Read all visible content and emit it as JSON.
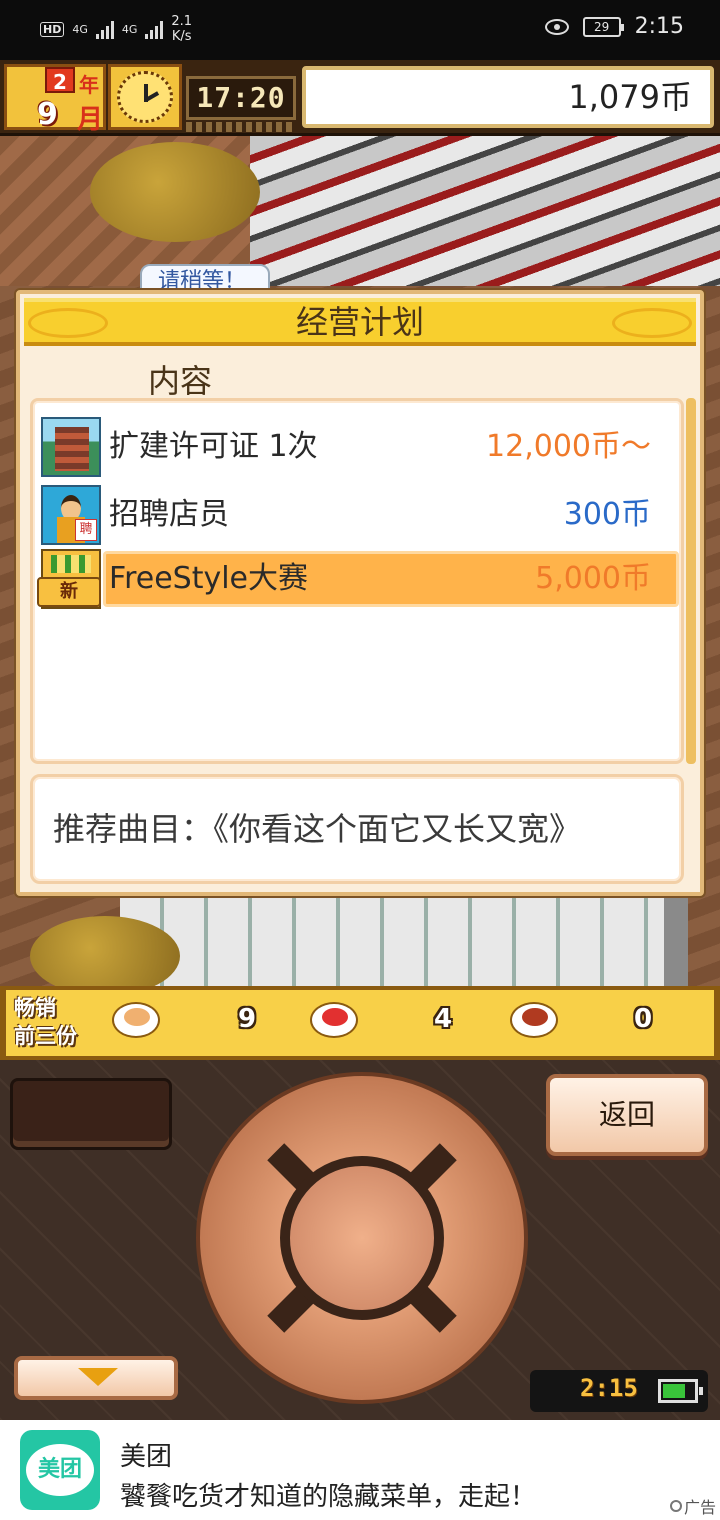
{
  "status_bar": {
    "hd": "HD",
    "net1": "4G",
    "net2": "4G",
    "speed_value": "2.1",
    "speed_unit": "K/s",
    "battery": "29",
    "time": "2:15"
  },
  "hud": {
    "year": "2",
    "year_unit": "年",
    "month": "9",
    "month_unit": "月",
    "game_time": "17:20",
    "money": "1,079币"
  },
  "scene": {
    "bubble_text": "请稍等！"
  },
  "dialog": {
    "title": "经营计划",
    "column_header": "内容",
    "plans": [
      {
        "name": "扩建许可证 1次",
        "price": "12,000币～",
        "price_color": "#f07a2a",
        "icon": "tower-icon"
      },
      {
        "name": "招聘店员",
        "price": "300币",
        "price_color": "#2a6ac8",
        "icon": "staff-icon",
        "tag": "聘"
      },
      {
        "name": "FreeStyle大赛",
        "price": "5,000币",
        "price_color": "#f07a2a",
        "icon": "trophy-icon",
        "badge": "新",
        "selected": true
      }
    ],
    "recommendation": "推荐曲目：《你看这个面它又长又宽》"
  },
  "best_sellers": {
    "title_line1": "畅销",
    "title_line2": "前三份",
    "items": [
      {
        "dish": "dumpling-dish-icon",
        "count": "9"
      },
      {
        "dish": "chili-dish-icon",
        "count": "4"
      },
      {
        "dish": "meat-dish-icon",
        "count": "0"
      }
    ]
  },
  "controls": {
    "back_label": "返回",
    "clock": "2:15"
  },
  "ad": {
    "logo_text": "美团",
    "title": "美团",
    "subtitle": "饕餮吃货才知道的隐藏菜单，走起！",
    "tag": "广告"
  },
  "colors": {
    "accent_orange": "#f07a2a",
    "accent_blue": "#2a6ac8",
    "dialog_header": "#f8cf2e",
    "selected_row": "#ffb34a"
  }
}
